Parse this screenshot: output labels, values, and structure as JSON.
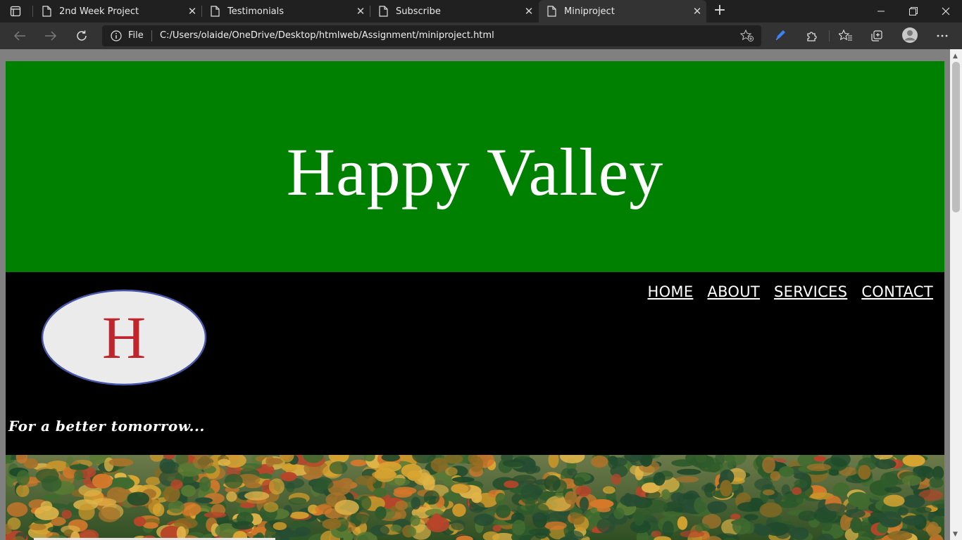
{
  "browser": {
    "tabs": [
      {
        "title": "2nd Week Project",
        "active": false
      },
      {
        "title": "Testimonials",
        "active": false
      },
      {
        "title": "Subscribe",
        "active": false
      },
      {
        "title": "Miniproject",
        "active": true
      }
    ],
    "address": {
      "scheme_label": "File",
      "url": "C:/Users/olaide/OneDrive/Desktop/htmlweb/Assignment/miniproject.html"
    }
  },
  "page": {
    "banner_title": "Happy Valley",
    "banner_color": "#008000",
    "logo_letter": "H",
    "nav": [
      "HOME",
      "ABOUT",
      "SERVICES",
      "CONTACT"
    ],
    "slogan": "For a better tomorrow..."
  },
  "icons": {
    "tab_actions": "tab-actions-icon",
    "doc": "document-icon",
    "close": "close-icon",
    "new_tab": "plus-icon",
    "back": "back-arrow-icon",
    "forward": "forward-arrow-icon",
    "refresh": "refresh-icon",
    "info": "info-icon",
    "favorite_add": "star-plus-icon",
    "pen": "pen-icon",
    "extensions": "puzzle-icon",
    "favorites": "favorites-icon",
    "collections": "collections-icon",
    "profile": "profile-icon",
    "more": "more-icon"
  }
}
